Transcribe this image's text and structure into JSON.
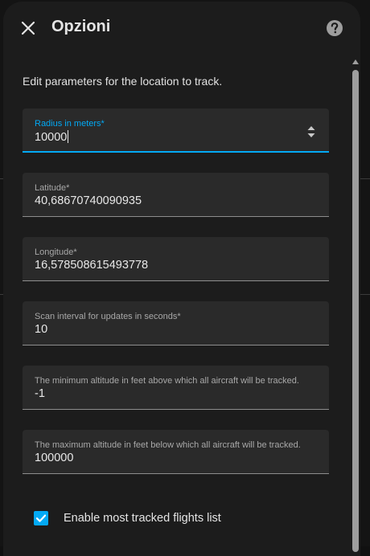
{
  "dialog": {
    "title": "Opzioni",
    "description": "Edit parameters for the location to track."
  },
  "fields": {
    "radius": {
      "label": "Radius in meters*",
      "value": "10000"
    },
    "latitude": {
      "label": "Latitude*",
      "value": "40,68670740090935"
    },
    "longitude": {
      "label": "Longitude*",
      "value": "16,578508615493778"
    },
    "scan_interval": {
      "label": "Scan interval for updates in seconds*",
      "value": "10"
    },
    "min_altitude": {
      "label": "The minimum altitude in feet above which all aircraft will be tracked.",
      "value": "-1"
    },
    "max_altitude": {
      "label": "The maximum altitude in feet below which all aircraft will be tracked.",
      "value": "100000"
    }
  },
  "checkbox": {
    "label": "Enable most tracked flights list",
    "checked": true
  },
  "icons": {
    "close": "close-icon",
    "help": "help-circle-icon",
    "spinner": "number-stepper-icon",
    "check": "check-icon"
  },
  "colors": {
    "accent": "#03a9f4",
    "dialog_bg": "#1c1c1c",
    "field_bg": "#2a2a2a"
  }
}
